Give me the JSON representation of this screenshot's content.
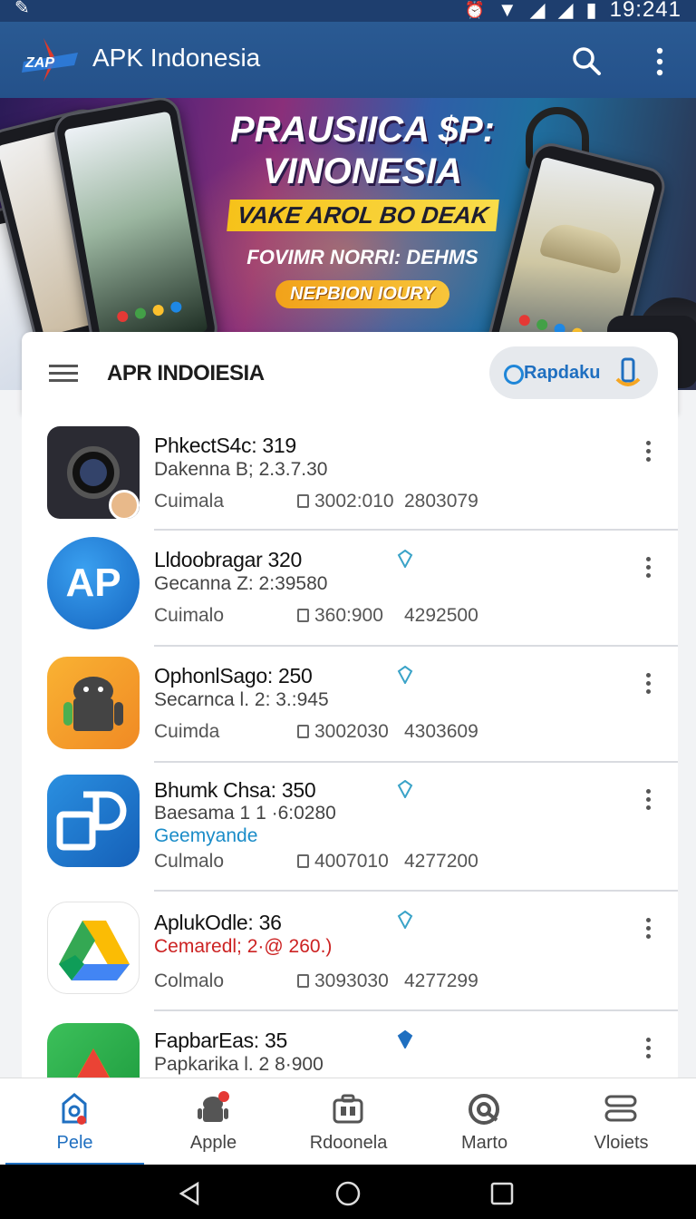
{
  "status_bar": {
    "time": "19:241",
    "icons": [
      "edit-icon",
      "alarm-icon",
      "wifi-icon",
      "signal-icon",
      "signal-icon",
      "battery-icon"
    ]
  },
  "app_bar": {
    "title": "APK Indonesia",
    "logo_text": "ZAP",
    "icons": [
      "search-icon",
      "more-vert-icon"
    ]
  },
  "banner": {
    "headline_1": "PRAUSIICA $P:",
    "headline_2": "VINONESIA",
    "tagline": "VAKE AROL BO DEAK",
    "subline": "FOVIMR NORRI: DEHMS",
    "cta": "NEPBION IOURY",
    "colors": {
      "tagline_bg": "#f6c21a",
      "cta_bg": "#f2a21a"
    }
  },
  "card_header": {
    "title": "APR INDOIESIA",
    "chip_label": "Rapdaku",
    "icons": [
      "menu-icon",
      "refresh-icon",
      "phone-badge-icon"
    ]
  },
  "apps": [
    {
      "name": "PhkectS4c: 319",
      "version": "Dakenna B; 2.3.7.30",
      "extra": "",
      "category": "Cuimala",
      "size": "3002:010",
      "downloads": "2803079",
      "shield": false,
      "icon": "camera-icon"
    },
    {
      "name": "Lldoobragar 320",
      "version": "Gecanna Z: 2:39580",
      "extra": "",
      "category": "Cuimalo",
      "size": "360:900",
      "downloads": "4292500",
      "shield": true,
      "icon": "ap-icon"
    },
    {
      "name": "OphonlSago: 250",
      "version": "Secarnca l. 2: 3.:945",
      "extra": "",
      "category": "Cuimda",
      "size": "3002030",
      "downloads": "4303609",
      "shield": true,
      "icon": "android-icon"
    },
    {
      "name": "Bhumk Chsa: 350",
      "version": "Baesama 1 1 ·6:0280",
      "extra": "Geemyande",
      "category": "Culmalo",
      "size": "4007010",
      "downloads": "4277200",
      "shield": true,
      "icon": "p-square-icon"
    },
    {
      "name": "AplukOdle: 36",
      "version": "Cemaredl; 2·@ 260.)",
      "extra": "",
      "category": "Colmalo",
      "size": "3093030",
      "downloads": "4277299",
      "shield": true,
      "icon": "drive-icon"
    },
    {
      "name": "FapbarEas: 35",
      "version": "Papkarika l. 2 8·900",
      "extra": "",
      "category": "",
      "size": "",
      "downloads": "",
      "shield": true,
      "icon": "drive-green-icon"
    }
  ],
  "bottom_nav": [
    {
      "label": "Pele",
      "icon": "home-pin-icon",
      "active": true
    },
    {
      "label": "Apple",
      "icon": "android-icon",
      "active": false
    },
    {
      "label": "Rdoonela",
      "icon": "briefcase-icon",
      "active": false
    },
    {
      "label": "Marto",
      "icon": "target-icon",
      "active": false
    },
    {
      "label": "Vloiets",
      "icon": "toggle-icon",
      "active": false
    }
  ],
  "colors": {
    "app_bar": "#2a5a93",
    "accent": "#1f6fc0",
    "version_red": "#cc2222"
  }
}
